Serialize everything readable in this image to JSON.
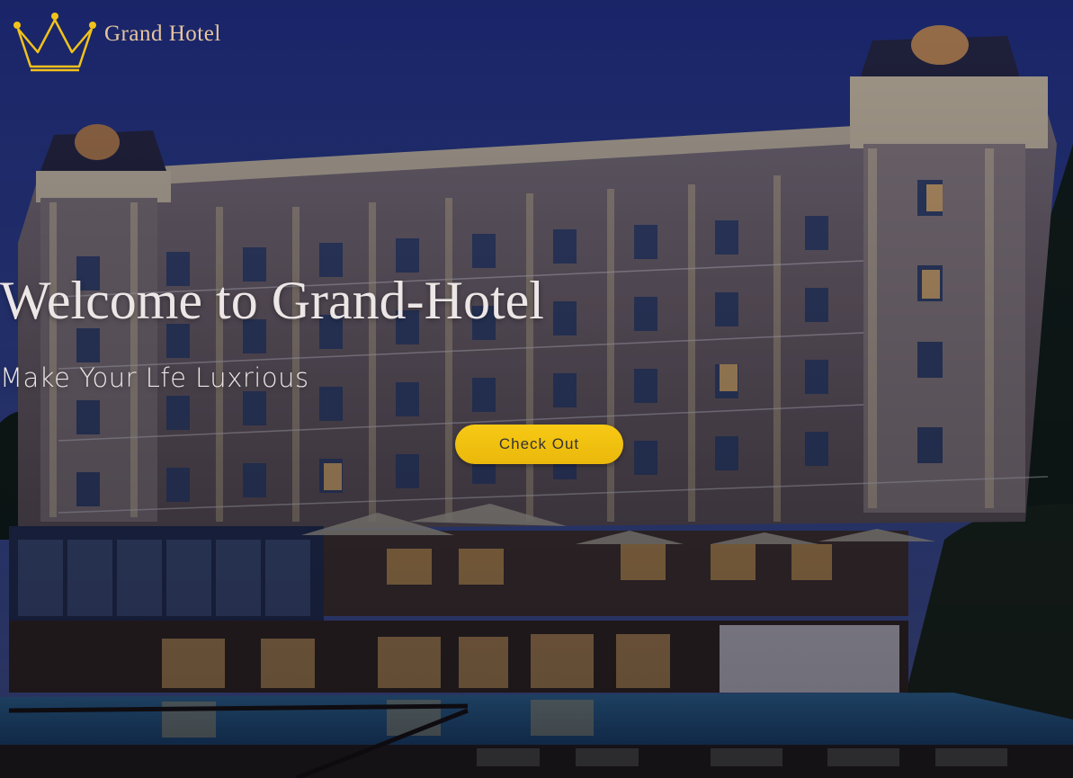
{
  "brand": {
    "name": "Grand Hotel",
    "logo_icon": "crown-icon",
    "logo_color": "#f2c21b",
    "name_color": "#e7c59e"
  },
  "hero": {
    "title": "Welcome to Grand-Hotel",
    "subtitle": "Make Your Lfe Luxrious",
    "cta_label": "Check Out",
    "cta_color": "#f4c212",
    "background": "hotel-facade-night-photo"
  }
}
